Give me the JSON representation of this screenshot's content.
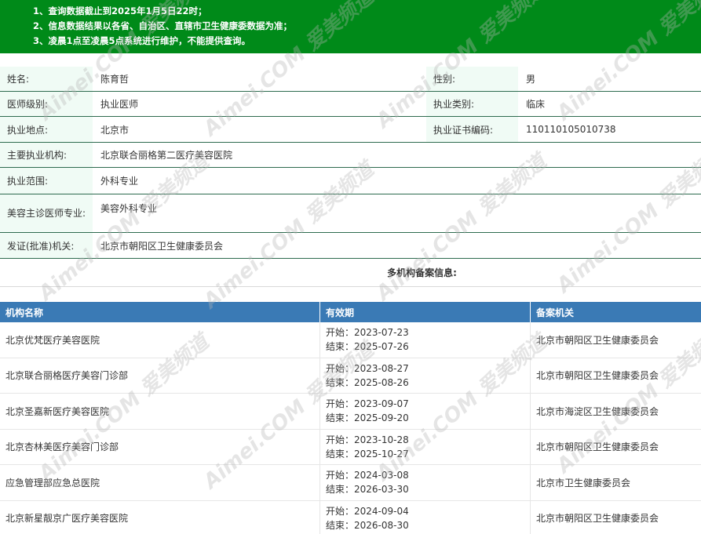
{
  "notice": {
    "lines": [
      "1、查询数据截止到2025年1月5日22时；",
      "2、信息数据结果以各省、自治区、直辖市卫生健康委数据为准；",
      "3、凌晨1点至凌晨5点系统进行维护，不能提供查询。"
    ]
  },
  "doctor": {
    "name_label": "姓名:",
    "name": "陈育哲",
    "gender_label": "性别:",
    "gender": "男",
    "level_label": "医师级别:",
    "level": "执业医师",
    "category_label": "执业类别:",
    "category": "临床",
    "location_label": "执业地点:",
    "location": "北京市",
    "cert_label": "执业证书编码:",
    "cert": "110110105010738",
    "institution_label": "主要执业机构:",
    "institution": "北京联合丽格第二医疗美容医院",
    "scope_label": "执业范围:",
    "scope": "外科专业",
    "specialty_label": "美容主诊医师专业:",
    "specialty": "美容外科专业",
    "authority_label": "发证(批准)机关:",
    "authority": "北京市朝阳区卫生健康委员会"
  },
  "multi": {
    "title": "多机构备案信息:",
    "headers": [
      "机构名称",
      "有效期",
      "备案机关"
    ],
    "rows": [
      {
        "name": "北京优梵医疗美容医院",
        "start": "开始：2023-07-23",
        "end": "结束：2025-07-26",
        "org": "北京市朝阳区卫生健康委员会"
      },
      {
        "name": "北京联合丽格医疗美容门诊部",
        "start": "开始：2023-08-27",
        "end": "结束：2025-08-26",
        "org": "北京市朝阳区卫生健康委员会"
      },
      {
        "name": "北京圣嘉新医疗美容医院",
        "start": "开始：2023-09-07",
        "end": "结束：2025-09-20",
        "org": "北京市海淀区卫生健康委员会"
      },
      {
        "name": "北京杏林美医疗美容门诊部",
        "start": "开始：2023-10-28",
        "end": "结束：2025-10-27",
        "org": "北京市朝阳区卫生健康委员会"
      },
      {
        "name": "应急管理部应急总医院",
        "start": "开始：2024-03-08",
        "end": "结束：2026-03-30",
        "org": "北京市卫生健康委员会"
      },
      {
        "name": "北京新星靓京广医疗美容医院",
        "start": "开始：2024-09-04",
        "end": "结束：2026-08-30",
        "org": "北京市朝阳区卫生健康委员会"
      }
    ]
  },
  "watermark": "Aimei.COM 爱美频道"
}
